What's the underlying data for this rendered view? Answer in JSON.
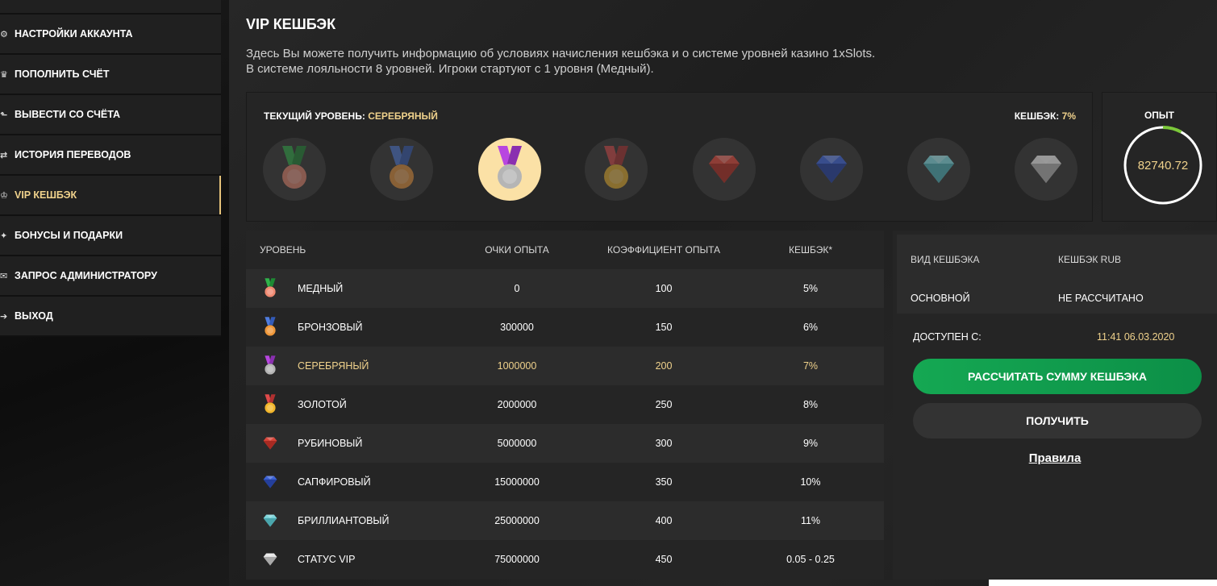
{
  "sidebar": {
    "items": [
      {
        "label": "НАСТРОЙКИ АККАУНТА",
        "icon": "settings-icon",
        "active": false
      },
      {
        "label": "ПОПОЛНИТЬ СЧЁТ",
        "icon": "deposit-icon",
        "active": false
      },
      {
        "label": "ВЫВЕСТИ СО СЧЁТА",
        "icon": "withdraw-icon",
        "active": false
      },
      {
        "label": "ИСТОРИЯ ПЕРЕВОДОВ",
        "icon": "transfer-history-icon",
        "active": false
      },
      {
        "label": "VIP КЕШБЭК",
        "icon": "vip-crown-icon",
        "active": true
      },
      {
        "label": "БОНУСЫ И ПОДАРКИ",
        "icon": "gift-icon",
        "active": false
      },
      {
        "label": "ЗАПРОС АДМИНИСТРАТОРУ",
        "icon": "admin-request-icon",
        "active": false
      },
      {
        "label": "ВЫХОД",
        "icon": "logout-icon",
        "active": false
      }
    ]
  },
  "header": {
    "title": "VIP КЕШБЭК",
    "intro_line1": "Здесь Вы можете получить информацию об условиях начисления кешбэка и о системе уровней казино 1xSlots.",
    "intro_line2": "В системе лояльности 8 уровней. Игроки стартуют с 1 уровня (Медный)."
  },
  "level_panel": {
    "current_label": "ТЕКУЩИЙ УРОВЕНЬ:",
    "current_value": "СЕРЕБРЯНЫЙ",
    "cashback_label": "КЕШБЭК:",
    "cashback_value": "7%",
    "active_index": 2
  },
  "xp_panel": {
    "title": "ОПЫТ",
    "value": "82740.72",
    "progress_fraction": 0.08
  },
  "levels_table": {
    "headers": [
      "УРОВЕНЬ",
      "ОЧКИ ОПЫТА",
      "КОЭФФИЦИЕНТ ОПЫТА",
      "КЕШБЭК*"
    ],
    "rows": [
      {
        "level": "МЕДНЫЙ",
        "points": "0",
        "coef": "100",
        "cashback": "5%",
        "icon": "copper-medal-icon"
      },
      {
        "level": "БРОНЗОВЫЙ",
        "points": "300000",
        "coef": "150",
        "cashback": "6%",
        "icon": "bronze-medal-icon"
      },
      {
        "level": "СЕРЕБРЯНЫЙ",
        "points": "1000000",
        "coef": "200",
        "cashback": "7%",
        "icon": "silver-medal-icon"
      },
      {
        "level": "ЗОЛОТОЙ",
        "points": "2000000",
        "coef": "250",
        "cashback": "8%",
        "icon": "gold-medal-icon"
      },
      {
        "level": "РУБИНОВЫЙ",
        "points": "5000000",
        "coef": "300",
        "cashback": "9%",
        "icon": "ruby-gem-icon"
      },
      {
        "level": "САПФИРОВЫЙ",
        "points": "15000000",
        "coef": "350",
        "cashback": "10%",
        "icon": "sapphire-gem-icon"
      },
      {
        "level": "БРИЛЛИАНТОВЫЙ",
        "points": "25000000",
        "coef": "400",
        "cashback": "11%",
        "icon": "diamond-gem-icon"
      },
      {
        "level": "СТАТУС VIP",
        "points": "75000000",
        "coef": "450",
        "cashback": "0.05 - 0.25",
        "icon": "vip-gem-icon"
      }
    ]
  },
  "cashback_panel": {
    "type_header": "ВИД КЕШБЭКА",
    "amount_header": "КЕШБЭК RUB",
    "type_value": "ОСНОВНОЙ",
    "amount_value": "НЕ РАССЧИТАНО",
    "available_label": "ДОСТУПЕН С:",
    "available_value": "11:41 06.03.2020",
    "calc_button": "РАССЧИТАТЬ СУММУ КЕШБЭКА",
    "get_button": "ПОЛУЧИТЬ",
    "rules_link": "Правила"
  },
  "colors": {
    "accent_gold": "#f0d28c",
    "green_button": "#15a853",
    "panel": "#252525"
  }
}
